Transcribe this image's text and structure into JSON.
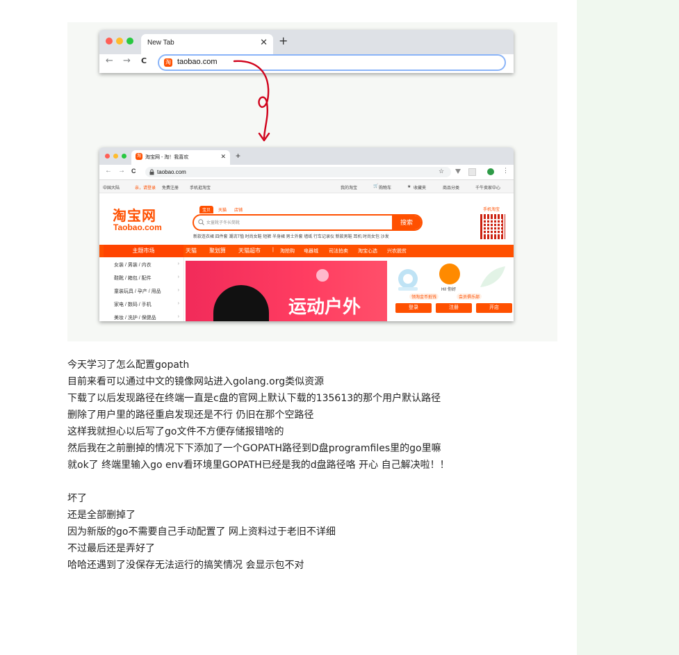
{
  "browser_top": {
    "tab_title": "New Tab",
    "tab_close": "✕",
    "new_tab": "+",
    "back": "←",
    "forward": "→",
    "reload": "C",
    "favicon": "淘",
    "url": "taobao.com"
  },
  "browser_bottom": {
    "tab_title": "淘宝网 - 淘！我喜欢",
    "tab_close": "✕",
    "new_tab": "+",
    "url": "taobao.com",
    "star": "☆",
    "site_topbar": {
      "region": "中国大陆",
      "login": "亲，请登录",
      "register": "免费注册",
      "mobile": "手机逛淘宝",
      "my_taobao": "我的淘宝",
      "cart": "购物车",
      "favorites": "收藏夹",
      "categories": "商品分类",
      "seller": "千牛卖家中心"
    },
    "logo_cn": "淘宝网",
    "logo_en": "Taobao.com",
    "search_tabs": [
      "宝贝",
      "天猫",
      "店铺"
    ],
    "search_placeholder": "女童靴子冬长筒靴",
    "search_button": "搜索",
    "hot_words": "新款连衣裙 四件套 潮流T恤 时尚女鞋 短裤 半身裙 男士外套 墙纸 行车记录仪 新款男鞋 耳机 时尚女包 沙发",
    "mobile_taobao": "手机淘宝",
    "nav_theme": "主题市场",
    "nav_items": [
      "天猫",
      "聚划算",
      "天猫超市",
      "|",
      "淘抢购",
      "电器城",
      "司法拍卖",
      "淘宝心选",
      "兴农脱贫"
    ],
    "categories": [
      "女装 / 男装 / 内衣",
      "鞋靴 / 箱包 / 配件",
      "童装玩具 / 孕产 / 用品",
      "家电 / 数码 / 手机",
      "美妆 / 洗护 / 保健品"
    ],
    "category_arrow": "›",
    "banner_text": "运动户外",
    "greeting": "Hi! 你好",
    "coupon": "领淘金币抵钱",
    "club": "会员俱乐部",
    "login_buttons": [
      "登录",
      "注册",
      "开店"
    ]
  },
  "text_lines": [
    "今天学习了怎么配置gopath",
    "目前来看可以通过中文的镜像网站进入golang.org类似资源",
    "下载了以后发现路径在终端一直是c盘的官网上默认下载的135613的那个用户默认路径",
    "删除了用户里的路径重启发现还是不行 仍旧在那个空路径",
    "这样我就担心以后写了go文件不方便存储报错啥的",
    "然后我在之前删掉的情况下下添加了一个GOPATH路径到D盘programfiles里的go里嘛",
    "就ok了 终端里输入go env看环境里GOPATH已经是我的d盘路径咯 开心 自己解决啦！！",
    "",
    "坏了",
    "还是全部删掉了",
    "因为新版的go不需要自己手动配置了 网上资料过于老旧不详细",
    "不过最后还是弄好了",
    "哈哈还遇到了没保存无法运行的搞笑情况 会显示包不对"
  ],
  "colors": {
    "taobao_orange": "#ff5000",
    "arrow_red": "#d0021b",
    "omnibox_focus": "#8ab4f8"
  }
}
